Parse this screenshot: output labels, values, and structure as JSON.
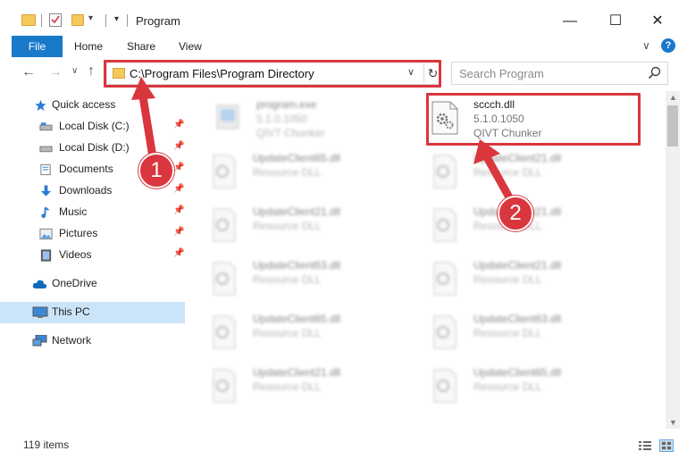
{
  "window": {
    "title": "Program",
    "minimize": "—",
    "maximize": "☐",
    "close": "✕"
  },
  "ribbon": {
    "file": "File",
    "tabs": [
      "Home",
      "Share",
      "View"
    ],
    "help": "?"
  },
  "address": {
    "path": "C:\\Program Files\\Program Directory",
    "refresh": "↻",
    "dropdown": "∨"
  },
  "search": {
    "placeholder": "Search Program"
  },
  "sidebar": {
    "items": [
      {
        "label": "Quick access",
        "icon": "star-icon"
      },
      {
        "label": "Local Disk (C:)",
        "icon": "drive-icon",
        "pinned": true
      },
      {
        "label": "Local Disk (D:)",
        "icon": "drive-icon",
        "pinned": true
      },
      {
        "label": "Documents",
        "icon": "documents-icon",
        "pinned": true
      },
      {
        "label": "Downloads",
        "icon": "download-icon",
        "pinned": true
      },
      {
        "label": "Music",
        "icon": "music-icon",
        "pinned": true
      },
      {
        "label": "Pictures",
        "icon": "pictures-icon",
        "pinned": true
      },
      {
        "label": "Videos",
        "icon": "videos-icon",
        "pinned": true
      },
      {
        "label": "OneDrive",
        "icon": "cloud-icon"
      },
      {
        "label": "This PC",
        "icon": "computer-icon",
        "selected": true
      },
      {
        "label": "Network",
        "icon": "network-icon"
      }
    ]
  },
  "files": {
    "left": [
      {
        "name": "program.exe",
        "line1": "5.1.0.1050",
        "line2": "QIVT Chunker"
      },
      {
        "name": "UpdateClient65.dll",
        "line1": "Resource DLL",
        "line2": ""
      },
      {
        "name": "UpdateClient21.dll",
        "line1": "Resource DLL",
        "line2": ""
      },
      {
        "name": "UpdateClient63.dll",
        "line1": "Resource DLL",
        "line2": ""
      },
      {
        "name": "UpdateClient65.dll",
        "line1": "Resource DLL",
        "line2": ""
      },
      {
        "name": "UpdateClient21.dll",
        "line1": "Resource DLL",
        "line2": ""
      }
    ],
    "right": [
      {
        "name": "sccch.dll",
        "line1": "5.1.0.1050",
        "line2": "QIVT Chunker"
      },
      {
        "name": "UpdateClient21.dll",
        "line1": "Resource DLL",
        "line2": ""
      },
      {
        "name": "UpdateClient21.dll",
        "line1": "Resource DLL",
        "line2": ""
      },
      {
        "name": "UpdateClient21.dll",
        "line1": "Resource DLL",
        "line2": ""
      },
      {
        "name": "UpdateClient63.dll",
        "line1": "Resource DLL",
        "line2": ""
      },
      {
        "name": "UpdateClient65.dll",
        "line1": "Resource DLL",
        "line2": ""
      }
    ]
  },
  "status": {
    "count": "119 items"
  },
  "callouts": {
    "one": "1",
    "two": "2"
  },
  "colors": {
    "accent": "#1979ca",
    "highlight": "#d9363e",
    "selected": "#cce4f7"
  }
}
